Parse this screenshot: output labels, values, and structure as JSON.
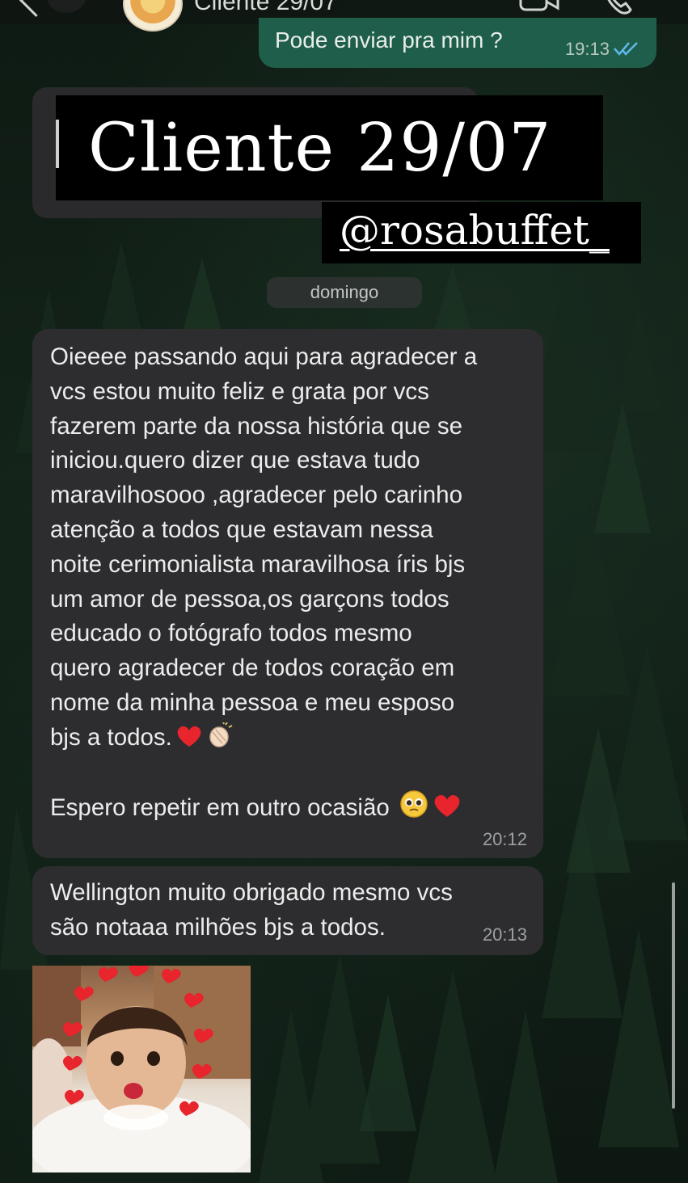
{
  "header": {
    "contact_name": "Cliente 29/07",
    "icons": [
      "back-chevron-icon",
      "video-call-icon",
      "phone-call-icon"
    ]
  },
  "outgoing": {
    "text": "Pode enviar pra mim ?",
    "time": "19:13",
    "status": "read-double-check-icon"
  },
  "overlay": {
    "title": "Cliente 29/07",
    "handle": "@rosabuffet_"
  },
  "date_separator": "domingo",
  "messages": [
    {
      "lines": [
        "Oieeee passando aqui para agradecer a",
        "vcs estou muito feliz e grata por vcs",
        "fazerem parte da nossa história que se",
        "iniciou.quero dizer que estava tudo",
        "maravilhosooo ,agradecer pelo carinho",
        "atenção a todos que estavam nessa",
        "noite cerimonialista maravilhosa íris bjs",
        "um amor de pessoa,os garçons todos",
        "educado o fotógrafo todos mesmo",
        "quero agradecer de todos coração em",
        "nome da minha pessoa e meu esposo",
        "bjs a todos."
      ],
      "second_paragraph": "Espero repetir em outro ocasião",
      "time": "20:12"
    },
    {
      "lines": [
        "Wellington muito obrigado mesmo vcs",
        "são notaaa milhões bjs a todos."
      ],
      "time": "20:13"
    }
  ],
  "colors": {
    "outgoing_bubble": "#1f5e4a",
    "incoming_bubble": "#2d2d30",
    "banner": "#000000",
    "heart": "#e8242d"
  }
}
